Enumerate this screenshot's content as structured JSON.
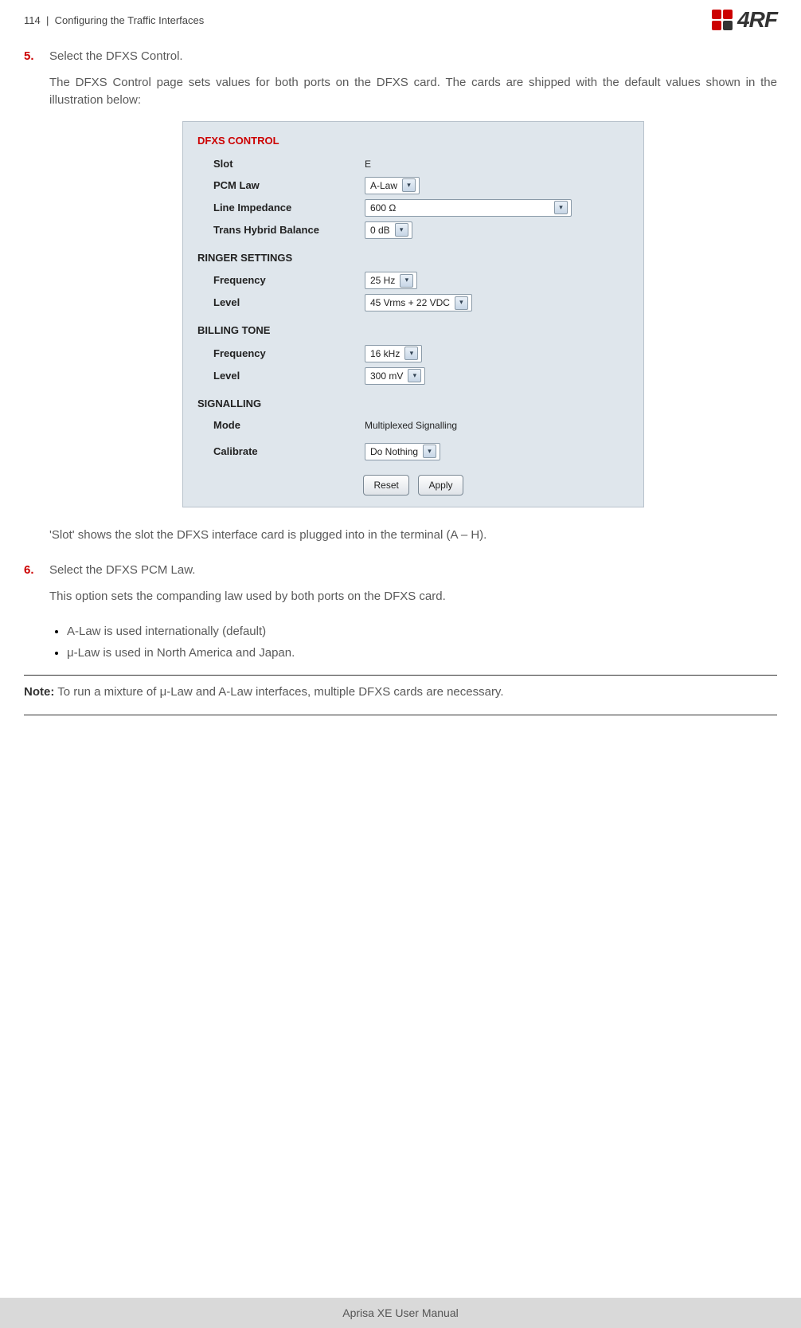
{
  "header": {
    "page_num": "114",
    "separator": "|",
    "section": "Configuring the Traffic Interfaces",
    "logo_text": "4RF"
  },
  "step5": {
    "num": "5.",
    "title": "Select the DFXS Control.",
    "desc": "The DFXS Control page sets values for both ports on the DFXS card. The cards are shipped with the default values shown in the illustration below:"
  },
  "panel": {
    "title": "DFXS CONTROL",
    "slot_label": "Slot",
    "slot_value": "E",
    "pcm_label": "PCM Law",
    "pcm_value": "A-Law",
    "imp_label": "Line Impedance",
    "imp_value": "600 Ω",
    "thb_label": "Trans Hybrid Balance",
    "thb_value": "0 dB",
    "ringer_title": "RINGER SETTINGS",
    "r_freq_label": "Frequency",
    "r_freq_value": "25 Hz",
    "r_level_label": "Level",
    "r_level_value": "45 Vrms + 22 VDC",
    "billing_title": "BILLING TONE",
    "b_freq_label": "Frequency",
    "b_freq_value": "16 kHz",
    "b_level_label": "Level",
    "b_level_value": "300 mV",
    "sig_title": "SIGNALLING",
    "mode_label": "Mode",
    "mode_value": "Multiplexed Signalling",
    "cal_label": "Calibrate",
    "cal_value": "Do Nothing",
    "reset_btn": "Reset",
    "apply_btn": "Apply"
  },
  "slot_note": "'Slot' shows the slot the DFXS interface card is plugged into in the terminal (A – H).",
  "step6": {
    "num": "6.",
    "title": "Select the DFXS PCM Law.",
    "desc": "This option sets the companding law used by both ports on the DFXS card.",
    "bullet1": "A-Law is used internationally (default)",
    "bullet2": "μ-Law is used in North America and Japan."
  },
  "note": {
    "label": "Note:",
    "text": " To run a mixture of μ-Law and A-Law interfaces, multiple DFXS cards are necessary."
  },
  "footer": "Aprisa XE User Manual"
}
